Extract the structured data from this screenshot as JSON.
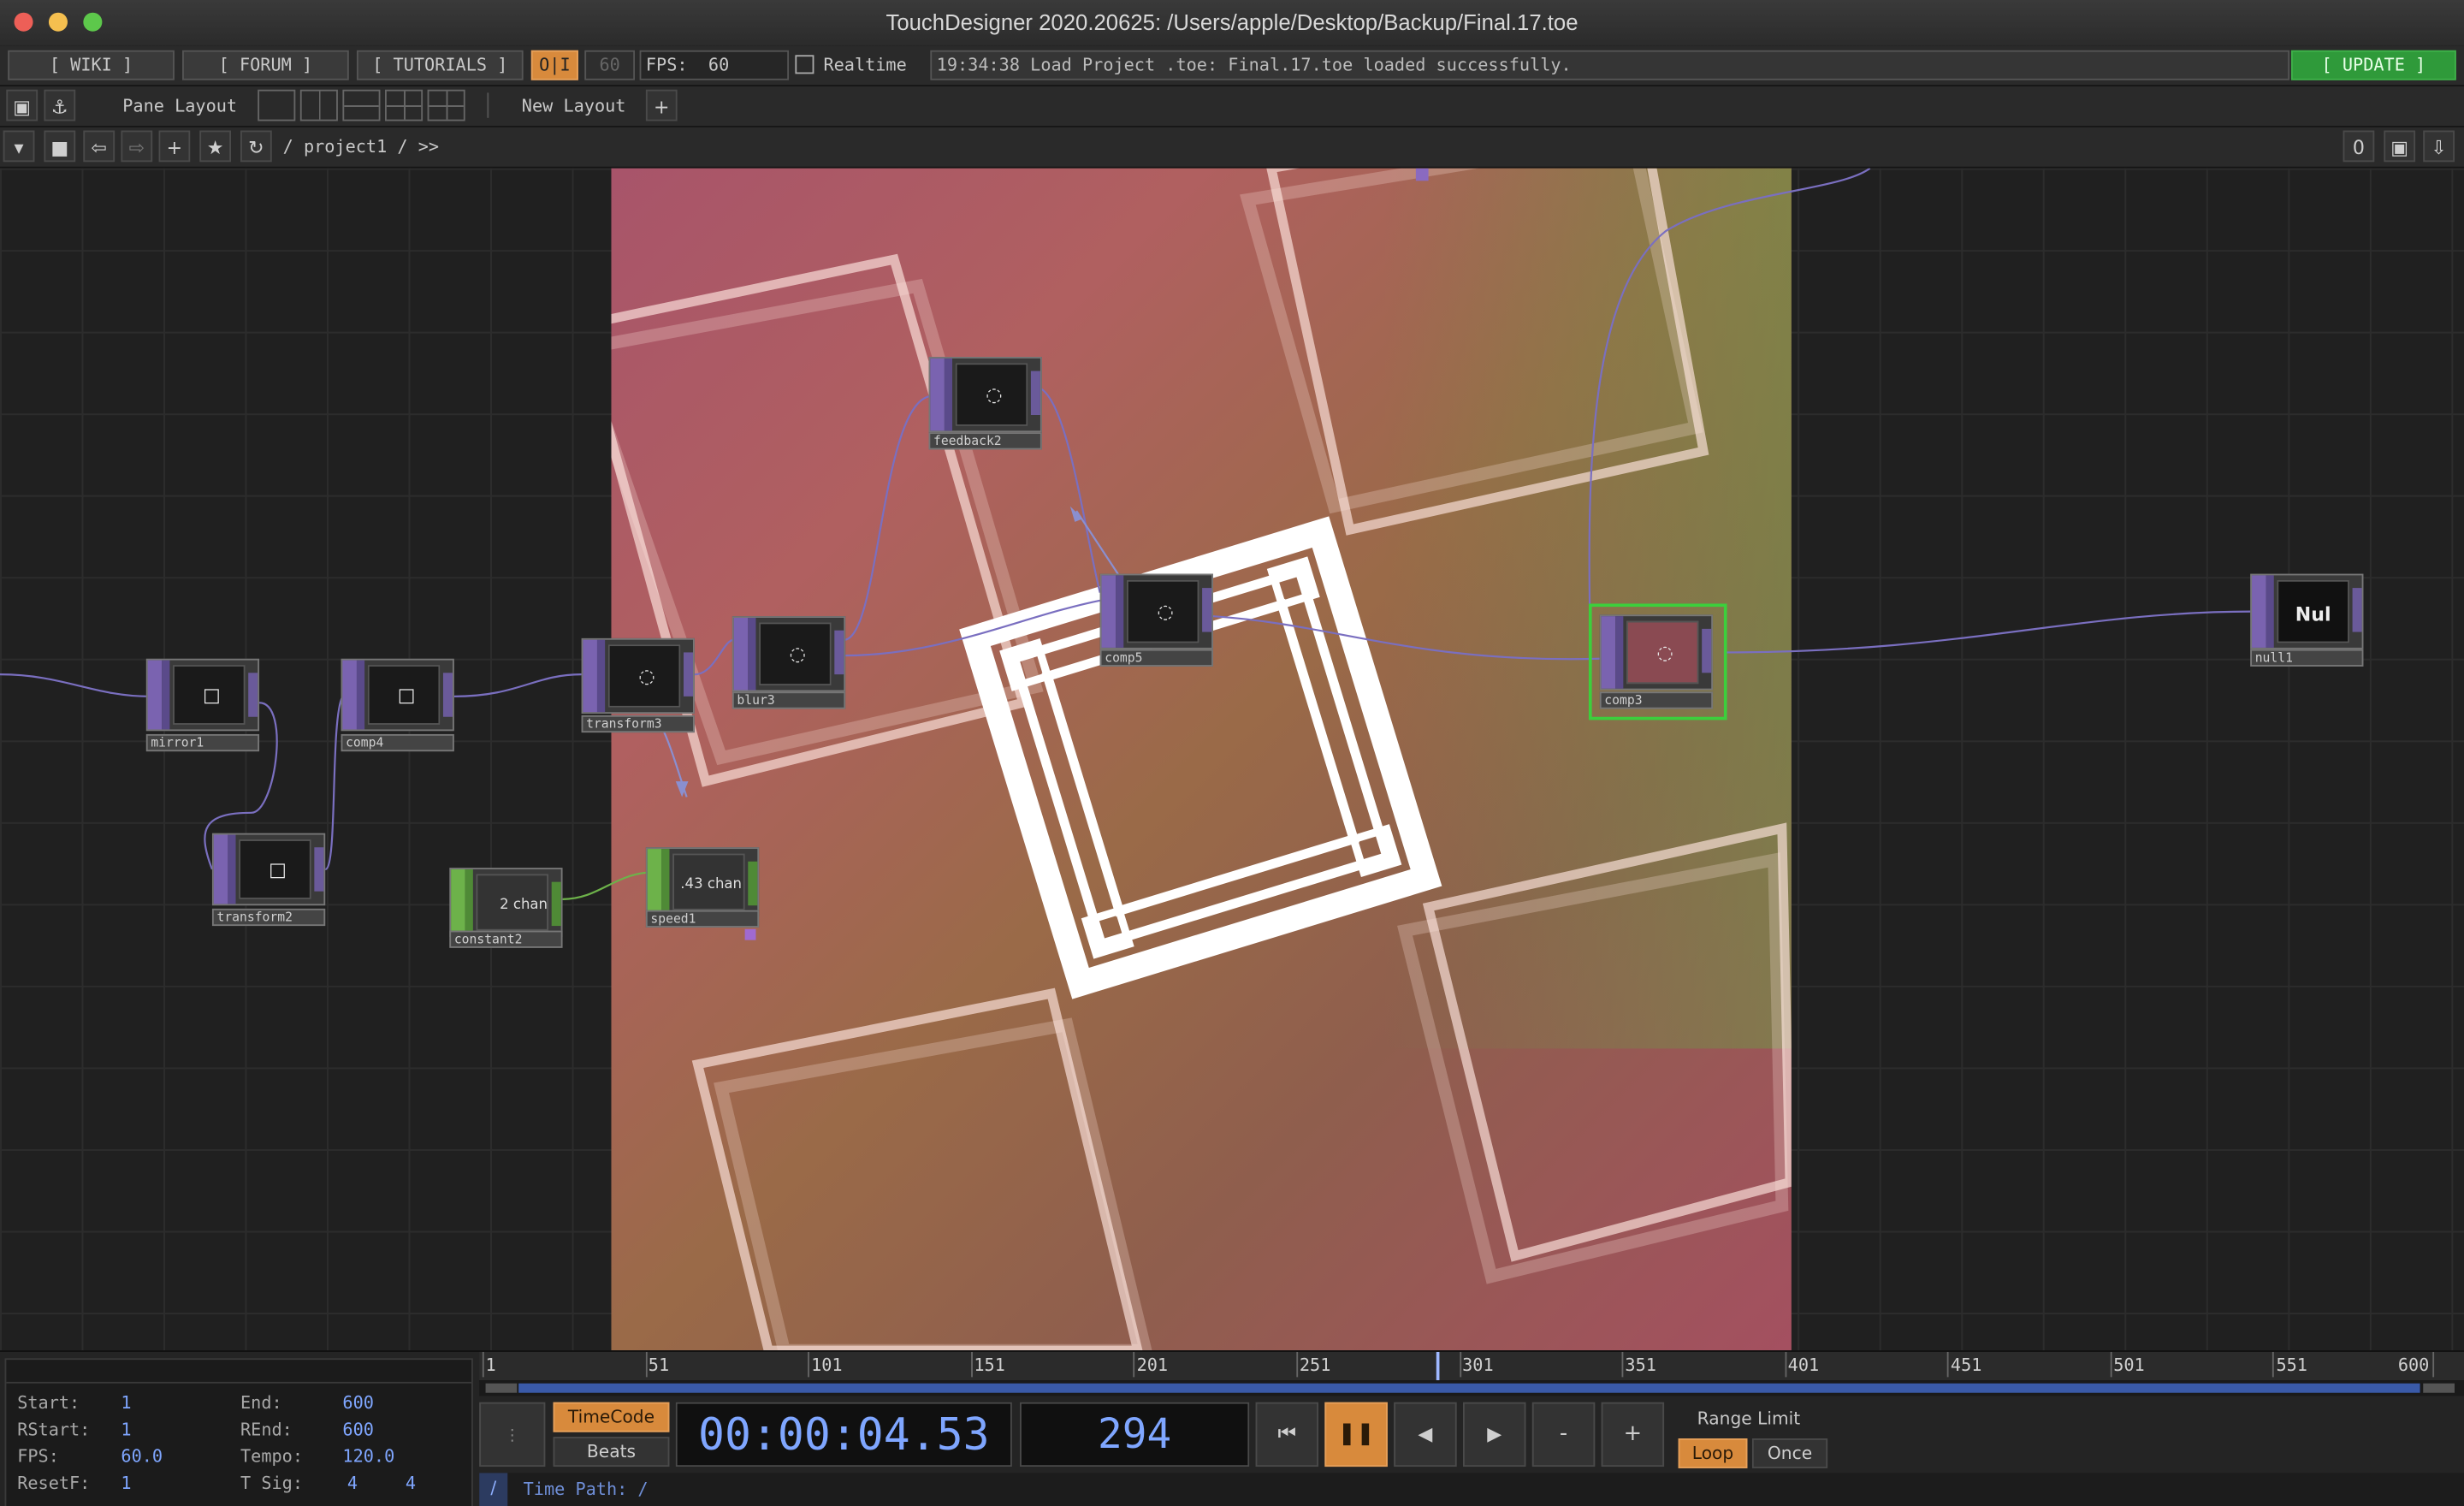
{
  "window": {
    "title": "TouchDesigner 2020.20625: /Users/apple/Desktop/Backup/Final.17.toe"
  },
  "toolbar": {
    "wiki": "[ WIKI ]",
    "forum": "[ FORUM ]",
    "tutorials": "[ TUTORIALS ]",
    "oi": "O|I",
    "fps_target": "60",
    "fps_label": "FPS:",
    "fps_value": "60",
    "realtime": "Realtime",
    "status": "19:34:38 Load Project .toe: Final.17.toe loaded successfully.",
    "update": "[ UPDATE ]"
  },
  "pane": {
    "pane_layout": "Pane Layout",
    "new_layout": "New Layout",
    "plus": "+"
  },
  "nav": {
    "path": "/ project1 / >>",
    "counter": "0"
  },
  "nodes": {
    "mirror1": "mirror1",
    "comp4": "comp4",
    "transform2": "transform2",
    "constant2": "constant2",
    "constant_val": "2 chan",
    "transform3": "transform3",
    "blur3": "blur3",
    "speed1": "speed1",
    "speed_val": ".43 chan",
    "feedback": "feedback2",
    "comp5": "comp5",
    "comp3": "comp3",
    "null1": "null1",
    "null_text": "Nul"
  },
  "timeline": {
    "ticks": [
      "1",
      "51",
      "101",
      "151",
      "201",
      "251",
      "301",
      "351",
      "401",
      "451",
      "501",
      "551",
      "600"
    ],
    "current_frame_marker": 294
  },
  "info": {
    "start_label": "Start:",
    "start": "1",
    "end_label": "End:",
    "end": "600",
    "rstart_label": "RStart:",
    "rstart": "1",
    "rend_label": "REnd:",
    "rend": "600",
    "fps_label": "FPS:",
    "fps": "60.0",
    "tempo_label": "Tempo:",
    "tempo": "120.0",
    "resetf_label": "ResetF:",
    "resetf": "1",
    "tsig_label": "T Sig:",
    "tsig1": "4",
    "tsig2": "4"
  },
  "transport": {
    "timecode": "TimeCode",
    "beats": "Beats",
    "time": "00:00:04.53",
    "frame": "294",
    "minus": "-",
    "plus": "+",
    "range_limit": "Range Limit",
    "loop": "Loop",
    "once": "Once",
    "time_path_sep": "/",
    "time_path": "Time Path: /"
  },
  "colors": {
    "accent_orange": "#d88a3c",
    "op_purple": "#7a63b0",
    "chop_green": "#6db24a",
    "time_blue": "#7fa6ff",
    "update_green": "#2f9a3a"
  }
}
